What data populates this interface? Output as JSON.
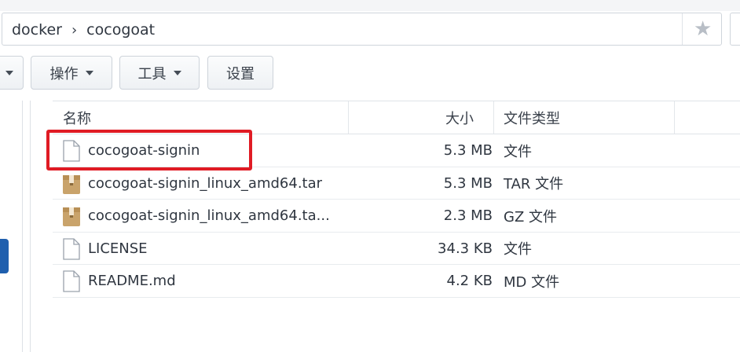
{
  "path": {
    "segments": [
      "docker",
      "cocogoat"
    ],
    "separator": "›"
  },
  "toolbar": {
    "action_label": "操作",
    "tools_label": "工具",
    "settings_label": "设置"
  },
  "table": {
    "columns": {
      "name": "名称",
      "size": "大小",
      "type": "文件类型"
    },
    "rows": [
      {
        "name": "cocogoat-signin",
        "size": "5.3 MB",
        "type": "文件",
        "icon": "file-icon"
      },
      {
        "name": "cocogoat-signin_linux_amd64.tar",
        "size": "5.3 MB",
        "type": "TAR 文件",
        "icon": "archive-icon"
      },
      {
        "name": "cocogoat-signin_linux_amd64.ta...",
        "size": "2.3 MB",
        "type": "GZ 文件",
        "icon": "archive-icon"
      },
      {
        "name": "LICENSE",
        "size": "34.3 KB",
        "type": "文件",
        "icon": "file-icon"
      },
      {
        "name": "README.md",
        "size": "4.2 KB",
        "type": "MD 文件",
        "icon": "file-icon"
      }
    ]
  },
  "colors": {
    "highlight": "#e01b24",
    "archive": "#c9a36b",
    "selection": "#1f5fae"
  }
}
